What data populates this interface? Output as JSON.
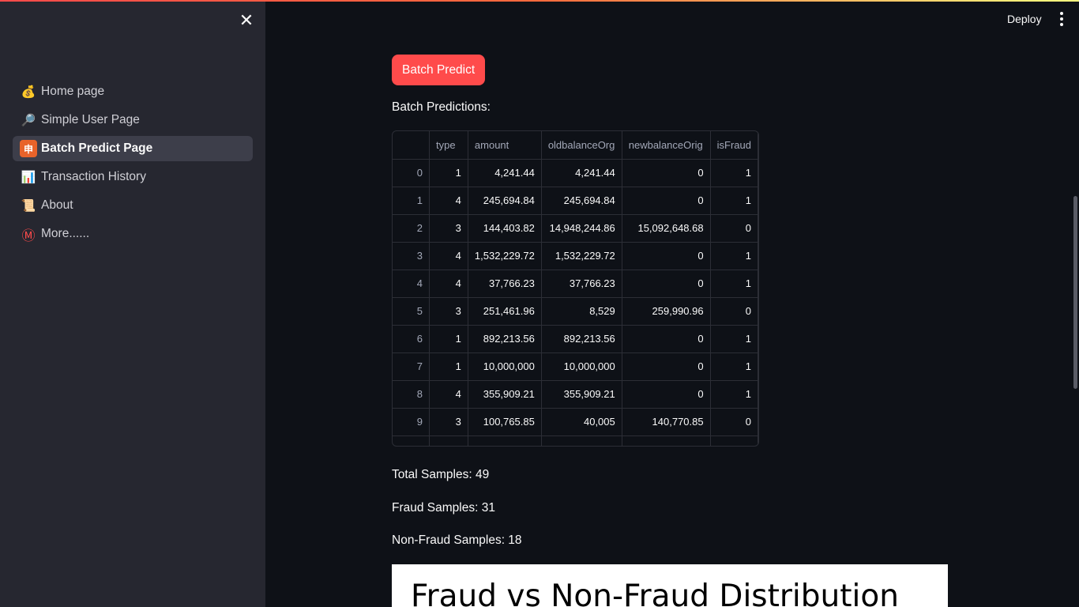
{
  "sidebar": {
    "items": [
      {
        "label": "Home page",
        "icon": "💰"
      },
      {
        "label": "Simple User Page",
        "icon": "🔎"
      },
      {
        "label": "Batch Predict Page",
        "icon": "🉑"
      },
      {
        "label": "Transaction History",
        "icon": "📊"
      },
      {
        "label": "About",
        "icon": "📜"
      },
      {
        "label": "More......",
        "icon": "Ⓜ"
      }
    ]
  },
  "header": {
    "deploy_label": "Deploy"
  },
  "main": {
    "batch_button": "Batch Predict",
    "predictions_label": "Batch Predictions:",
    "table": {
      "columns": [
        "",
        "type",
        "amount",
        "oldbalanceOrg",
        "newbalanceOrig",
        "isFraud"
      ],
      "rows": [
        [
          "0",
          "1",
          "4,241.44",
          "4,241.44",
          "0",
          "1"
        ],
        [
          "1",
          "4",
          "245,694.84",
          "245,694.84",
          "0",
          "1"
        ],
        [
          "2",
          "3",
          "144,403.82",
          "14,948,244.86",
          "15,092,648.68",
          "0"
        ],
        [
          "3",
          "4",
          "1,532,229.72",
          "1,532,229.72",
          "0",
          "1"
        ],
        [
          "4",
          "4",
          "37,766.23",
          "37,766.23",
          "0",
          "1"
        ],
        [
          "5",
          "3",
          "251,461.96",
          "8,529",
          "259,990.96",
          "0"
        ],
        [
          "6",
          "1",
          "892,213.56",
          "892,213.56",
          "0",
          "1"
        ],
        [
          "7",
          "1",
          "10,000,000",
          "10,000,000",
          "0",
          "1"
        ],
        [
          "8",
          "4",
          "355,909.21",
          "355,909.21",
          "0",
          "1"
        ],
        [
          "9",
          "3",
          "100,765.85",
          "40,005",
          "140,770.85",
          "0"
        ]
      ]
    },
    "total_samples": "Total Samples: 49",
    "fraud_samples": "Fraud Samples: 31",
    "nonfraud_samples": "Non-Fraud Samples: 18",
    "chart_title": "Fraud vs Non-Fraud Distribution"
  }
}
